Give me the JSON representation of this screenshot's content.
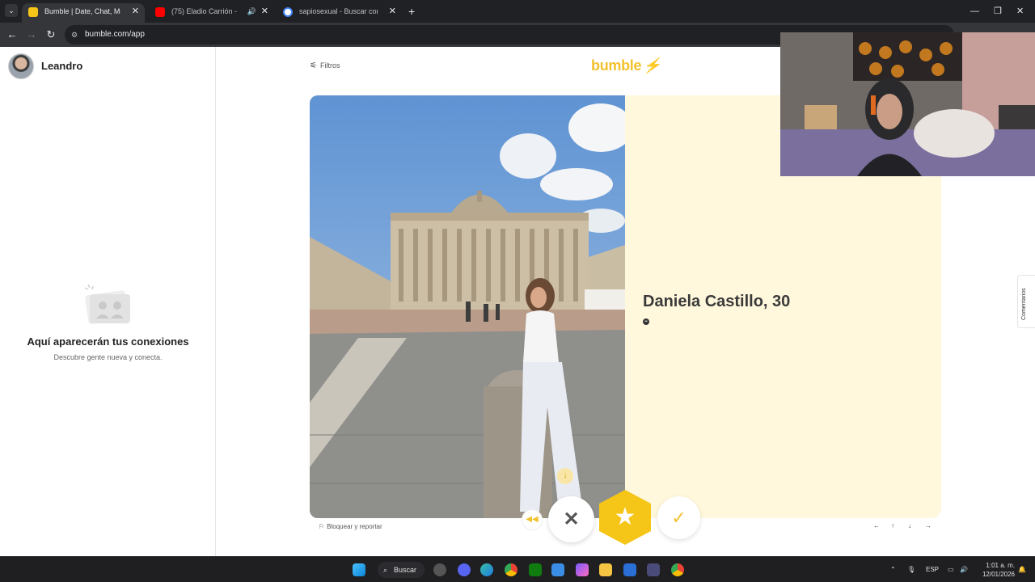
{
  "browser": {
    "tabs": [
      {
        "title": "Bumble | Date, Chat, Meet New",
        "active": true,
        "favicon_color": "#f5c518"
      },
      {
        "title": "(75) Eladio Carrión - Fé, Co",
        "active": false,
        "favicon_color": "#ff0000",
        "audio": true
      },
      {
        "title": "sapiosexual - Buscar con Goog",
        "active": false,
        "favicon_color": "#4285f4"
      }
    ],
    "url": "bumble.com/app"
  },
  "sidebar": {
    "user_name": "Leandro",
    "empty_title": "Aquí aparecerán tus conexiones",
    "empty_subtitle": "Descubre gente nueva y conecta."
  },
  "header": {
    "filters_label": "Filtros",
    "logo_text": "bumble",
    "logo_color": "#f2c12e"
  },
  "profile": {
    "name_age": "Daniela Castillo, 30",
    "panel_color": "#fff8dc"
  },
  "footer": {
    "report_label": "Bloquear y reportar",
    "shortcut_arrows": [
      "←",
      "↑",
      "↓",
      "→"
    ]
  },
  "side_tab": {
    "label": "Comentarios"
  },
  "taskbar": {
    "search_label": "Buscar",
    "language": "ESP",
    "time": "1:01 a. m.",
    "date": "12/01/2026"
  }
}
